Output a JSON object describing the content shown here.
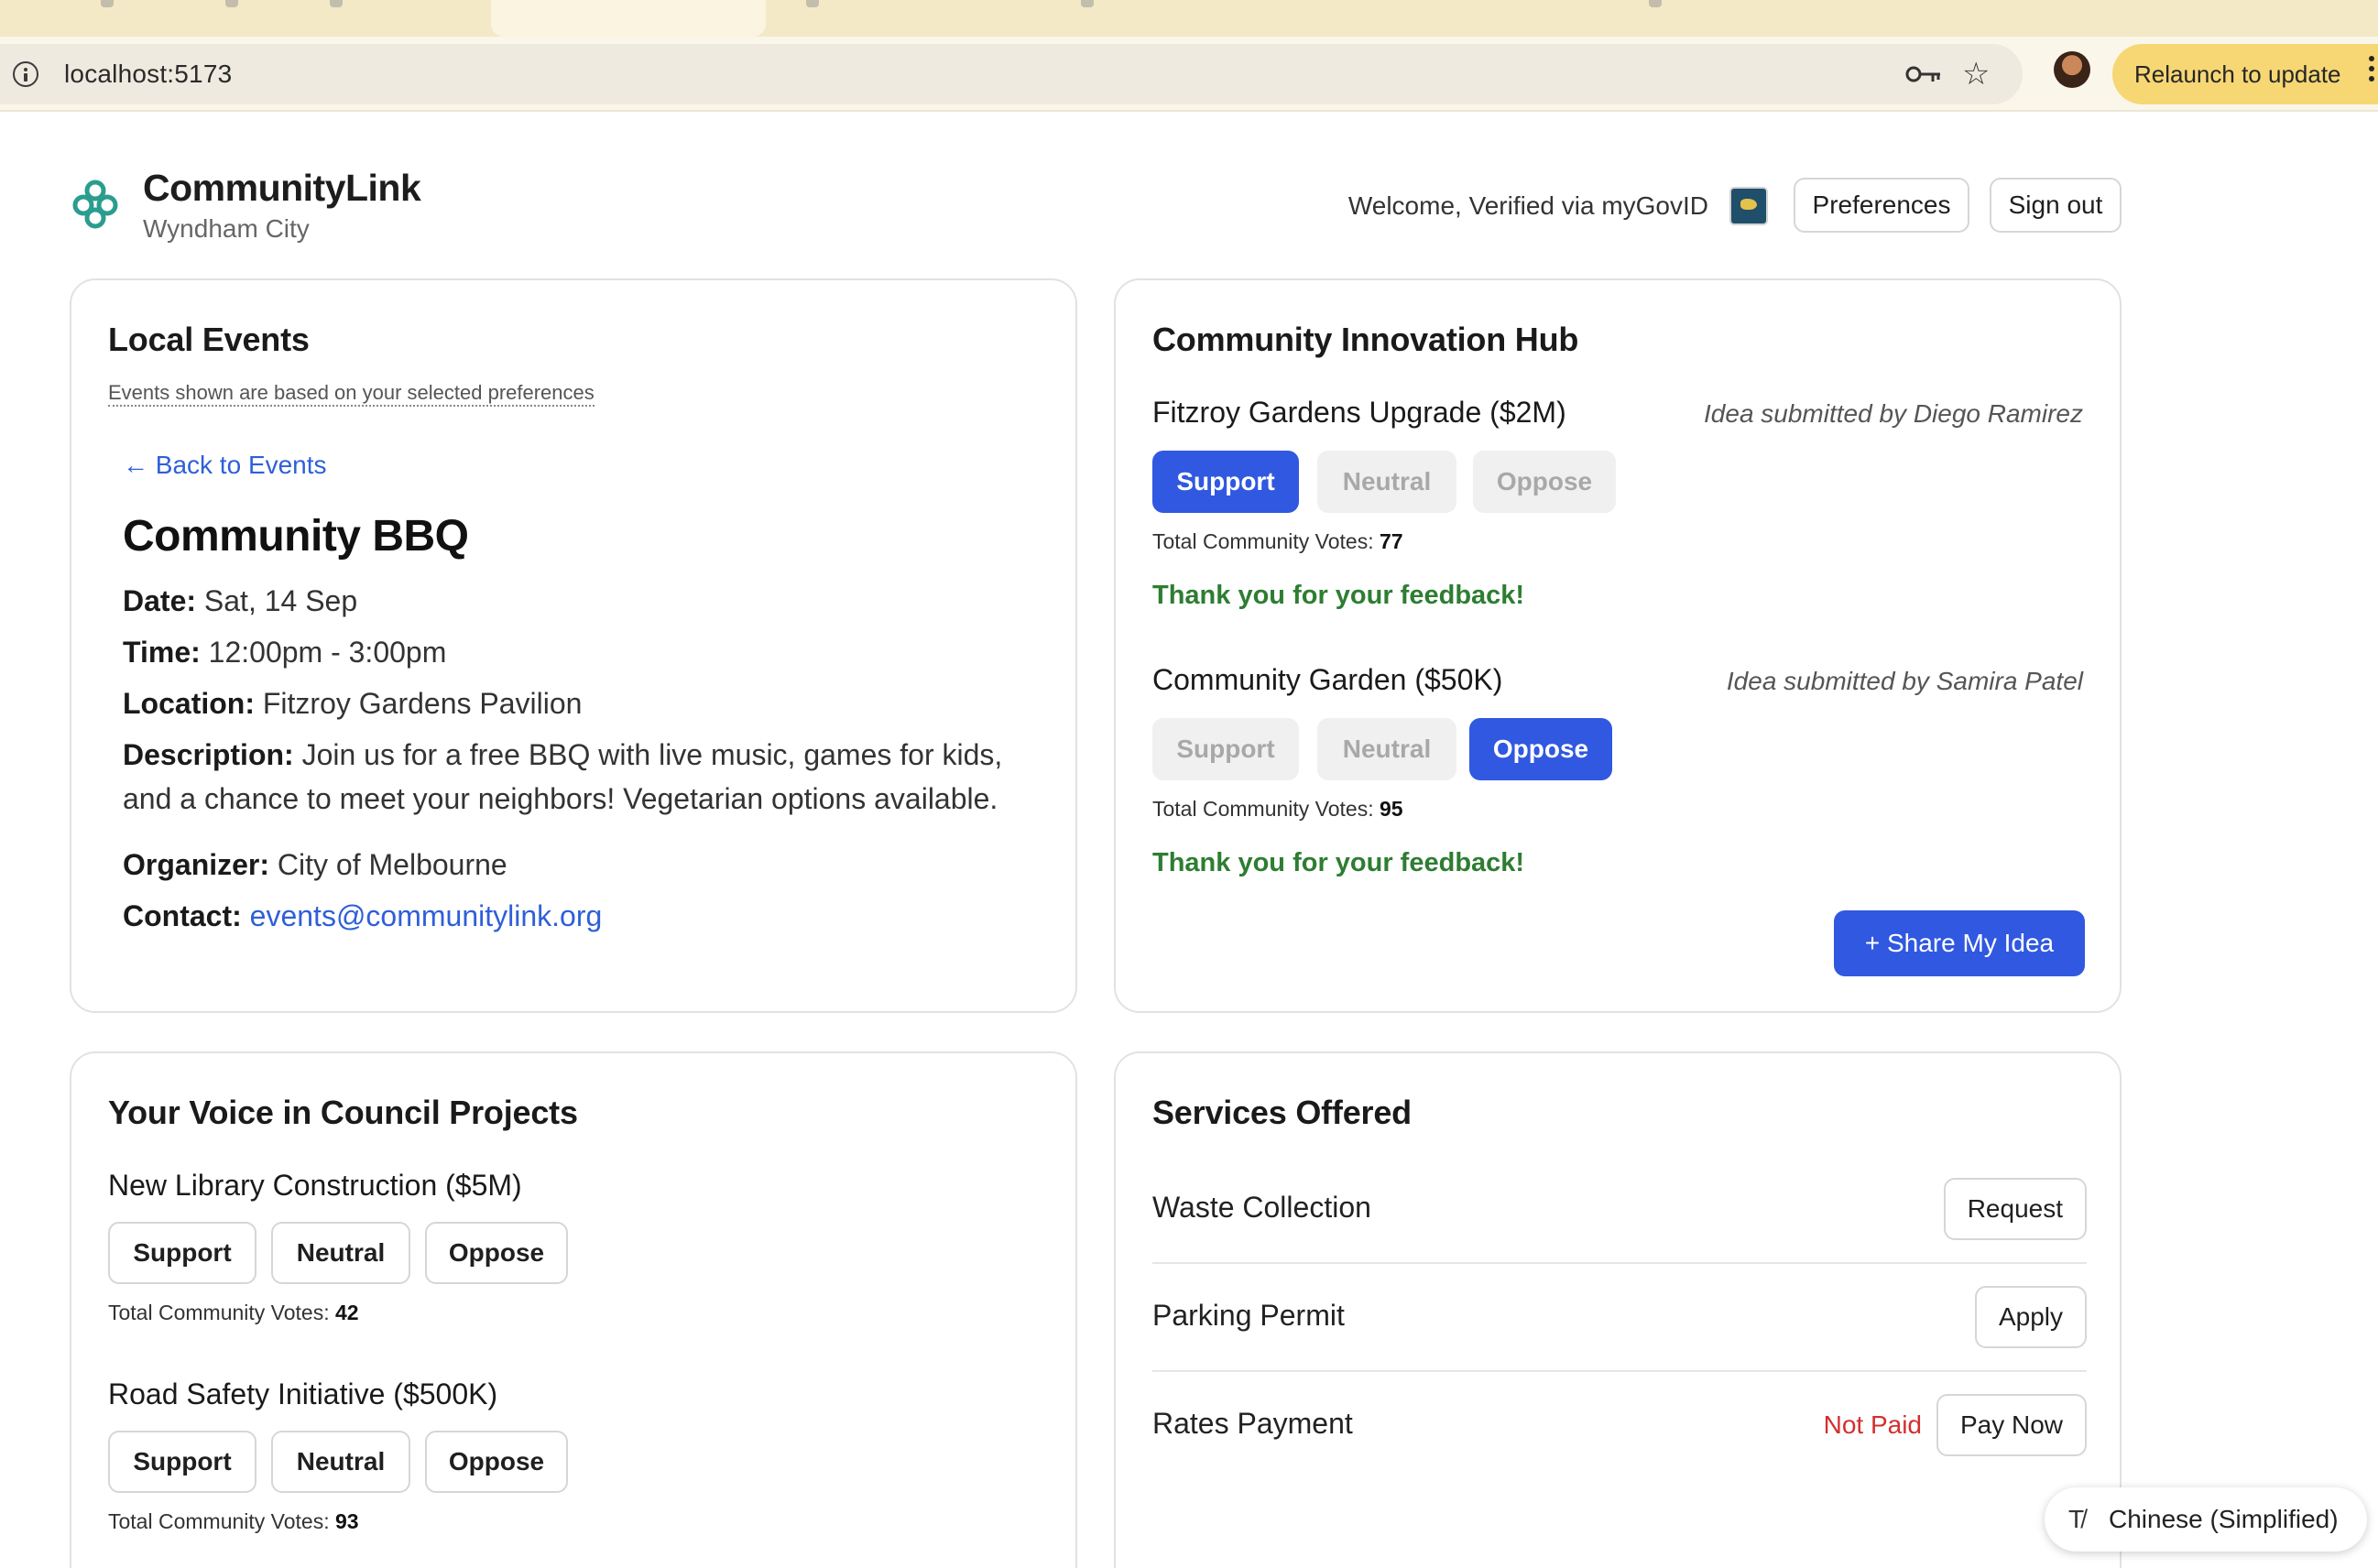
{
  "browser": {
    "url": "localhost:5173",
    "relaunch_label": "Relaunch to update"
  },
  "header": {
    "app_name": "CommunityLink",
    "city": "Wyndham City",
    "welcome": "Welcome, Verified via myGovID",
    "preferences_label": "Preferences",
    "signout_label": "Sign out"
  },
  "events": {
    "title": "Local Events",
    "note": "Events shown are based on your selected preferences",
    "back_label": "← Back to Events",
    "event": {
      "name": "Community BBQ",
      "date_label": "Date:",
      "date": "Sat, 14 Sep",
      "time_label": "Time:",
      "time": "12:00pm - 3:00pm",
      "location_label": "Location:",
      "location": "Fitzroy Gardens Pavilion",
      "description_label": "Description:",
      "description": "Join us for a free BBQ with live music, games for kids, and a chance to meet your neighbors! Vegetarian options available.",
      "organizer_label": "Organizer:",
      "organizer": "City of Melbourne",
      "contact_label": "Contact:",
      "contact": "events@communitylink.org"
    }
  },
  "innovation": {
    "title": "Community Innovation Hub",
    "ideas": [
      {
        "title": "Fitzroy Gardens Upgrade ($2M)",
        "submitted_by": "Idea submitted by Diego Ramirez",
        "support": "Support",
        "neutral": "Neutral",
        "oppose": "Oppose",
        "selected": "support",
        "votes_label": "Total Community Votes:",
        "votes": "77",
        "feedback": "Thank you for your feedback!"
      },
      {
        "title": "Community Garden ($50K)",
        "submitted_by": "Idea submitted by Samira Patel",
        "support": "Support",
        "neutral": "Neutral",
        "oppose": "Oppose",
        "selected": "oppose",
        "votes_label": "Total Community Votes:",
        "votes": "95",
        "feedback": "Thank you for your feedback!"
      }
    ],
    "share_label": "+ Share My Idea"
  },
  "council": {
    "title": "Your Voice in Council Projects",
    "projects": [
      {
        "title": "New Library Construction ($5M)",
        "support": "Support",
        "neutral": "Neutral",
        "oppose": "Oppose",
        "votes_label": "Total Community Votes:",
        "votes": "42"
      },
      {
        "title": "Road Safety Initiative ($500K)",
        "support": "Support",
        "neutral": "Neutral",
        "oppose": "Oppose",
        "votes_label": "Total Community Votes:",
        "votes": "93"
      }
    ]
  },
  "services": {
    "title": "Services Offered",
    "items": [
      {
        "label": "Waste Collection",
        "action": "Request"
      },
      {
        "label": "Parking Permit",
        "action": "Apply"
      },
      {
        "label": "Rates Payment",
        "status": "Not Paid",
        "action": "Pay Now"
      }
    ]
  },
  "translate": {
    "label": "Chinese (Simplified)"
  },
  "colors": {
    "primary": "#3058e0",
    "success": "#2e7d32",
    "danger": "#d32f2f",
    "link": "#2f5fd8",
    "relaunch": "#f7d774"
  }
}
